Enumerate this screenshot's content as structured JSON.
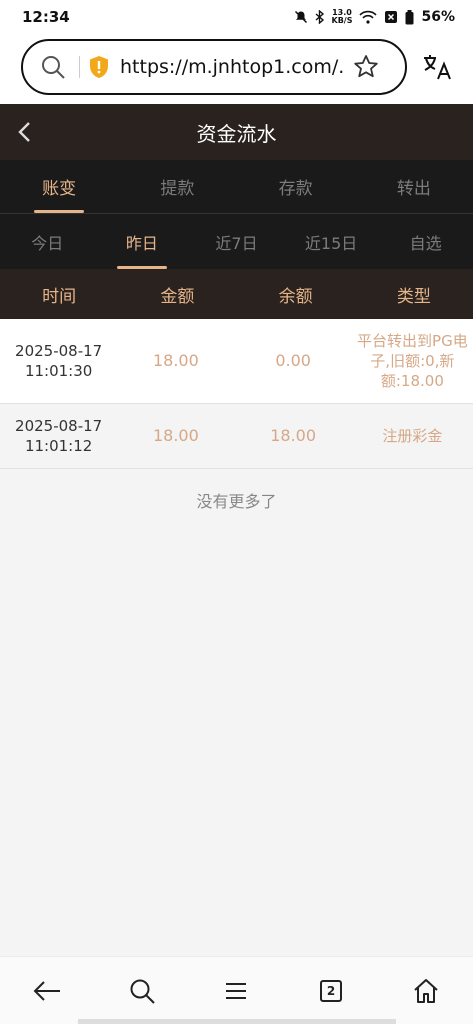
{
  "status": {
    "time": "12:34",
    "speed_top": "13.0",
    "speed_bottom": "KB/S",
    "battery": "56%"
  },
  "browser": {
    "url": "https://m.jnhtop1.com/...",
    "tab_count": "2"
  },
  "header": {
    "title": "资金流水"
  },
  "tabs": [
    {
      "label": "账变",
      "active": true
    },
    {
      "label": "提款",
      "active": false
    },
    {
      "label": "存款",
      "active": false
    },
    {
      "label": "转出",
      "active": false
    }
  ],
  "subtabs": [
    {
      "label": "今日",
      "active": false
    },
    {
      "label": "昨日",
      "active": true
    },
    {
      "label": "近7日",
      "active": false
    },
    {
      "label": "近15日",
      "active": false
    },
    {
      "label": "自选",
      "active": false
    }
  ],
  "table": {
    "headers": [
      "时间",
      "金额",
      "余额",
      "类型"
    ],
    "rows": [
      {
        "date": "2025-08-17",
        "clock": "11:01:30",
        "amount": "18.00",
        "balance": "0.00",
        "type": "平台转出到PG电子,旧额:0,新额:18.00"
      },
      {
        "date": "2025-08-17",
        "clock": "11:01:12",
        "amount": "18.00",
        "balance": "18.00",
        "type": "注册彩金"
      }
    ]
  },
  "footer_text": "没有更多了",
  "colors": {
    "accent": "#e5b48a",
    "header_bg": "#2a221e",
    "tab_bg": "#1a1a1a"
  }
}
